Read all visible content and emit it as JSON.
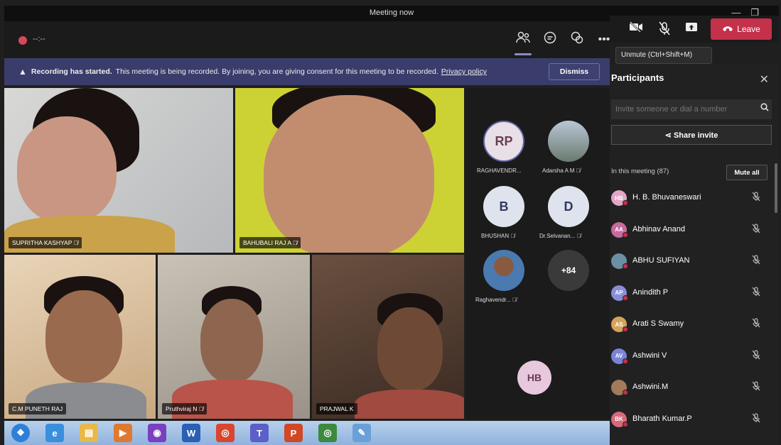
{
  "window": {
    "title": "Meeting now",
    "minimize_glyph": "—",
    "maximize_glyph": "❐"
  },
  "toolbar": {
    "timer": "--:--",
    "icons": [
      "people-icon",
      "chat-icon",
      "reactions-icon",
      "more-icon"
    ],
    "more_glyph": "•••",
    "camera_icon": "camera-off-icon",
    "mic_icon": "mic-off-icon",
    "share_icon": "share-tray-icon",
    "leave_label": "Leave",
    "accent": "#c4314b"
  },
  "tooltip": {
    "text": "Unmute (Ctrl+Shift+M)"
  },
  "banner": {
    "title": "Recording has started.",
    "message": "This meeting is being recorded. By joining, you are giving consent for this meeting to be recorded.",
    "link": "Privacy policy",
    "dismiss_label": "Dismiss",
    "background": "#3a3d6b"
  },
  "videos": [
    {
      "name": "SUPRITHA KASHYAP"
    },
    {
      "name": "BAHUBALI RAJ A"
    },
    {
      "name": "C.M PUNETH RAJ"
    },
    {
      "name": "Pruthviraj N"
    },
    {
      "name": "PRAJWAL K"
    }
  ],
  "gallery": {
    "avatars": [
      {
        "initials": "RP",
        "label": "RAGHAVENDR..."
      },
      {
        "initials": "",
        "label": "Adarsha A M"
      },
      {
        "initials": "B",
        "label": "BHUSHAN"
      },
      {
        "initials": "D",
        "label": "Dr.Selvanan..."
      },
      {
        "initials": "",
        "label": "Raghavendr..."
      },
      {
        "initials": "+84",
        "label": ""
      }
    ],
    "self_initials": "HB"
  },
  "participants": {
    "title": "Participants",
    "invite_placeholder": "Invite someone or dial a number",
    "share_invite_label": "Share invite",
    "in_meeting_label": "In this meeting (87)",
    "mute_all_label": "Mute all",
    "list": [
      {
        "initials": "HB",
        "name": "H. B. Bhuvaneswari",
        "color": "#e3a5c7"
      },
      {
        "initials": "AA",
        "name": "Abhinav Anand",
        "color": "#c76aa0"
      },
      {
        "initials": "",
        "name": "ABHU SUFIYAN",
        "color": "#6b8fa3"
      },
      {
        "initials": "AP",
        "name": "Anindith P",
        "color": "#8a8ed8"
      },
      {
        "initials": "AS",
        "name": "Arati S Swamy",
        "color": "#d6a35c"
      },
      {
        "initials": "AV",
        "name": "Ashwini V",
        "color": "#7b83d6"
      },
      {
        "initials": "",
        "name": "Ashwini.M",
        "color": "#a37a5c"
      },
      {
        "initials": "BK",
        "name": "Bharath Kumar.P",
        "color": "#d66a7b"
      }
    ]
  },
  "taskbar": {
    "apps": [
      {
        "name": "start-orb",
        "glyph": "❖",
        "color": "#2f7fd8"
      },
      {
        "name": "internet-explorer",
        "glyph": "e",
        "color": "#3a8fdd"
      },
      {
        "name": "file-explorer",
        "glyph": "▤",
        "color": "#e8b84a"
      },
      {
        "name": "media-player",
        "glyph": "▶",
        "color": "#e0792f"
      },
      {
        "name": "firefox",
        "glyph": "◉",
        "color": "#7b3fbf"
      },
      {
        "name": "word",
        "glyph": "W",
        "color": "#2b5fb3"
      },
      {
        "name": "chrome",
        "glyph": "◎",
        "color": "#d9462f"
      },
      {
        "name": "teams",
        "glyph": "T",
        "color": "#5b5fc7"
      },
      {
        "name": "powerpoint",
        "glyph": "P",
        "color": "#d24726"
      },
      {
        "name": "chrome-2",
        "glyph": "◎",
        "color": "#3b8a3e"
      },
      {
        "name": "paint",
        "glyph": "✎",
        "color": "#6aa0d8"
      }
    ]
  }
}
